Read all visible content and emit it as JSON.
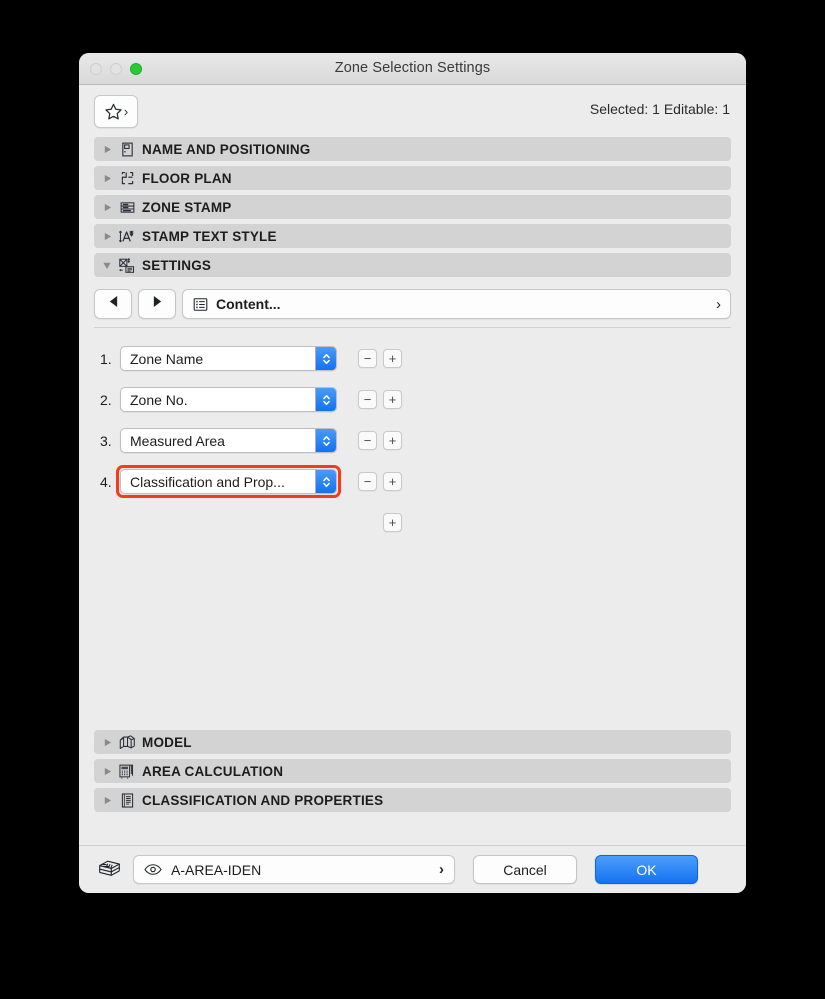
{
  "window": {
    "title": "Zone Selection Settings",
    "traffic_lights": [
      "close-disabled",
      "minimize-disabled",
      "zoom-green"
    ]
  },
  "toolbar": {
    "favorites_icon": "star-icon",
    "favorites_chevron": "›",
    "selection_info": "Selected: 1 Editable: 1"
  },
  "sections_top": [
    {
      "label": "NAME AND POSITIONING",
      "icon": "door-panel-icon",
      "expanded": false
    },
    {
      "label": "FLOOR PLAN",
      "icon": "floor-plan-icon",
      "expanded": false
    },
    {
      "label": "ZONE STAMP",
      "icon": "zone-stamp-icon",
      "expanded": false
    },
    {
      "label": "STAMP TEXT STYLE",
      "icon": "text-style-icon",
      "expanded": false
    },
    {
      "label": "SETTINGS",
      "icon": "settings-grid-icon",
      "expanded": true
    }
  ],
  "settings": {
    "nav_prev_icon": "triangle-left-icon",
    "nav_next_icon": "triangle-right-icon",
    "content_icon": "content-list-icon",
    "content_label": "Content...",
    "content_chevron": "›",
    "minus_label": "−",
    "plus_label": "+",
    "rows": [
      {
        "number": "1.",
        "value": "Zone Name",
        "highlighted": false
      },
      {
        "number": "2.",
        "value": "Zone No.",
        "highlighted": false
      },
      {
        "number": "3.",
        "value": "Measured Area",
        "highlighted": false
      },
      {
        "number": "4.",
        "value": "Classification and Prop...",
        "highlighted": true
      }
    ],
    "add_button_label": "+",
    "highlight_color": "#f8391a"
  },
  "sections_bottom": [
    {
      "label": "MODEL",
      "icon": "3d-model-icon",
      "expanded": false
    },
    {
      "label": "AREA CALCULATION",
      "icon": "calculator-icon",
      "expanded": false
    },
    {
      "label": "CLASSIFICATION AND PROPERTIES",
      "icon": "document-list-icon",
      "expanded": false
    }
  ],
  "footer": {
    "layers_icon": "layers-stack-icon",
    "visibility_icon": "eye-icon",
    "layer_name": "A-AREA-IDEN",
    "layer_chevron": "›",
    "cancel_label": "Cancel",
    "ok_label": "OK",
    "ok_color": "#1573f2"
  }
}
